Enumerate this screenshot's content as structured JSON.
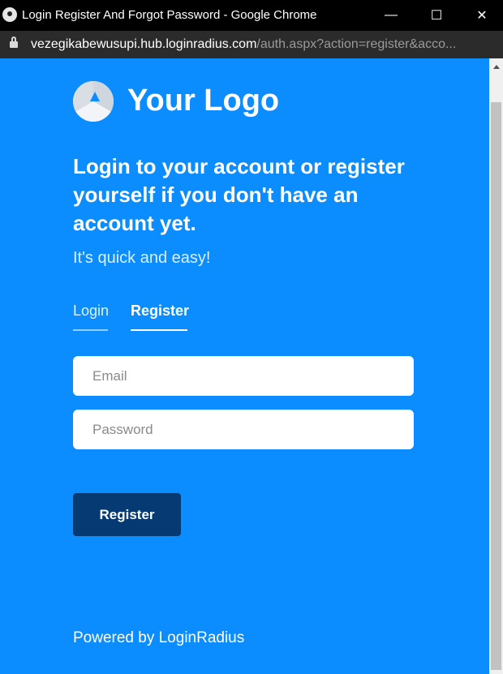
{
  "window": {
    "title": "Login Register And Forgot Password - Google Chrome",
    "controls": {
      "minimize": "—",
      "maximize": "☐",
      "close": "✕"
    }
  },
  "address_bar": {
    "domain": "vezegikabewusupi.hub.loginradius.com",
    "path": "/auth.aspx?action=register&acco..."
  },
  "logo": {
    "text": "Your Logo",
    "icon": "logo-icon"
  },
  "heading": "Login to your account or register yourself if you don't have an account yet.",
  "subheading": "It's quick and easy!",
  "tabs": [
    {
      "label": "Login",
      "active": false
    },
    {
      "label": "Register",
      "active": true
    }
  ],
  "form": {
    "email_placeholder": "Email",
    "password_placeholder": "Password",
    "submit_label": "Register"
  },
  "footer": {
    "powered_by": "Powered by LoginRadius"
  },
  "colors": {
    "background": "#0b8cff",
    "button": "#063a73",
    "tab_underline_active": "#ffffff",
    "tab_underline_inactive": "#8fd0ff"
  }
}
